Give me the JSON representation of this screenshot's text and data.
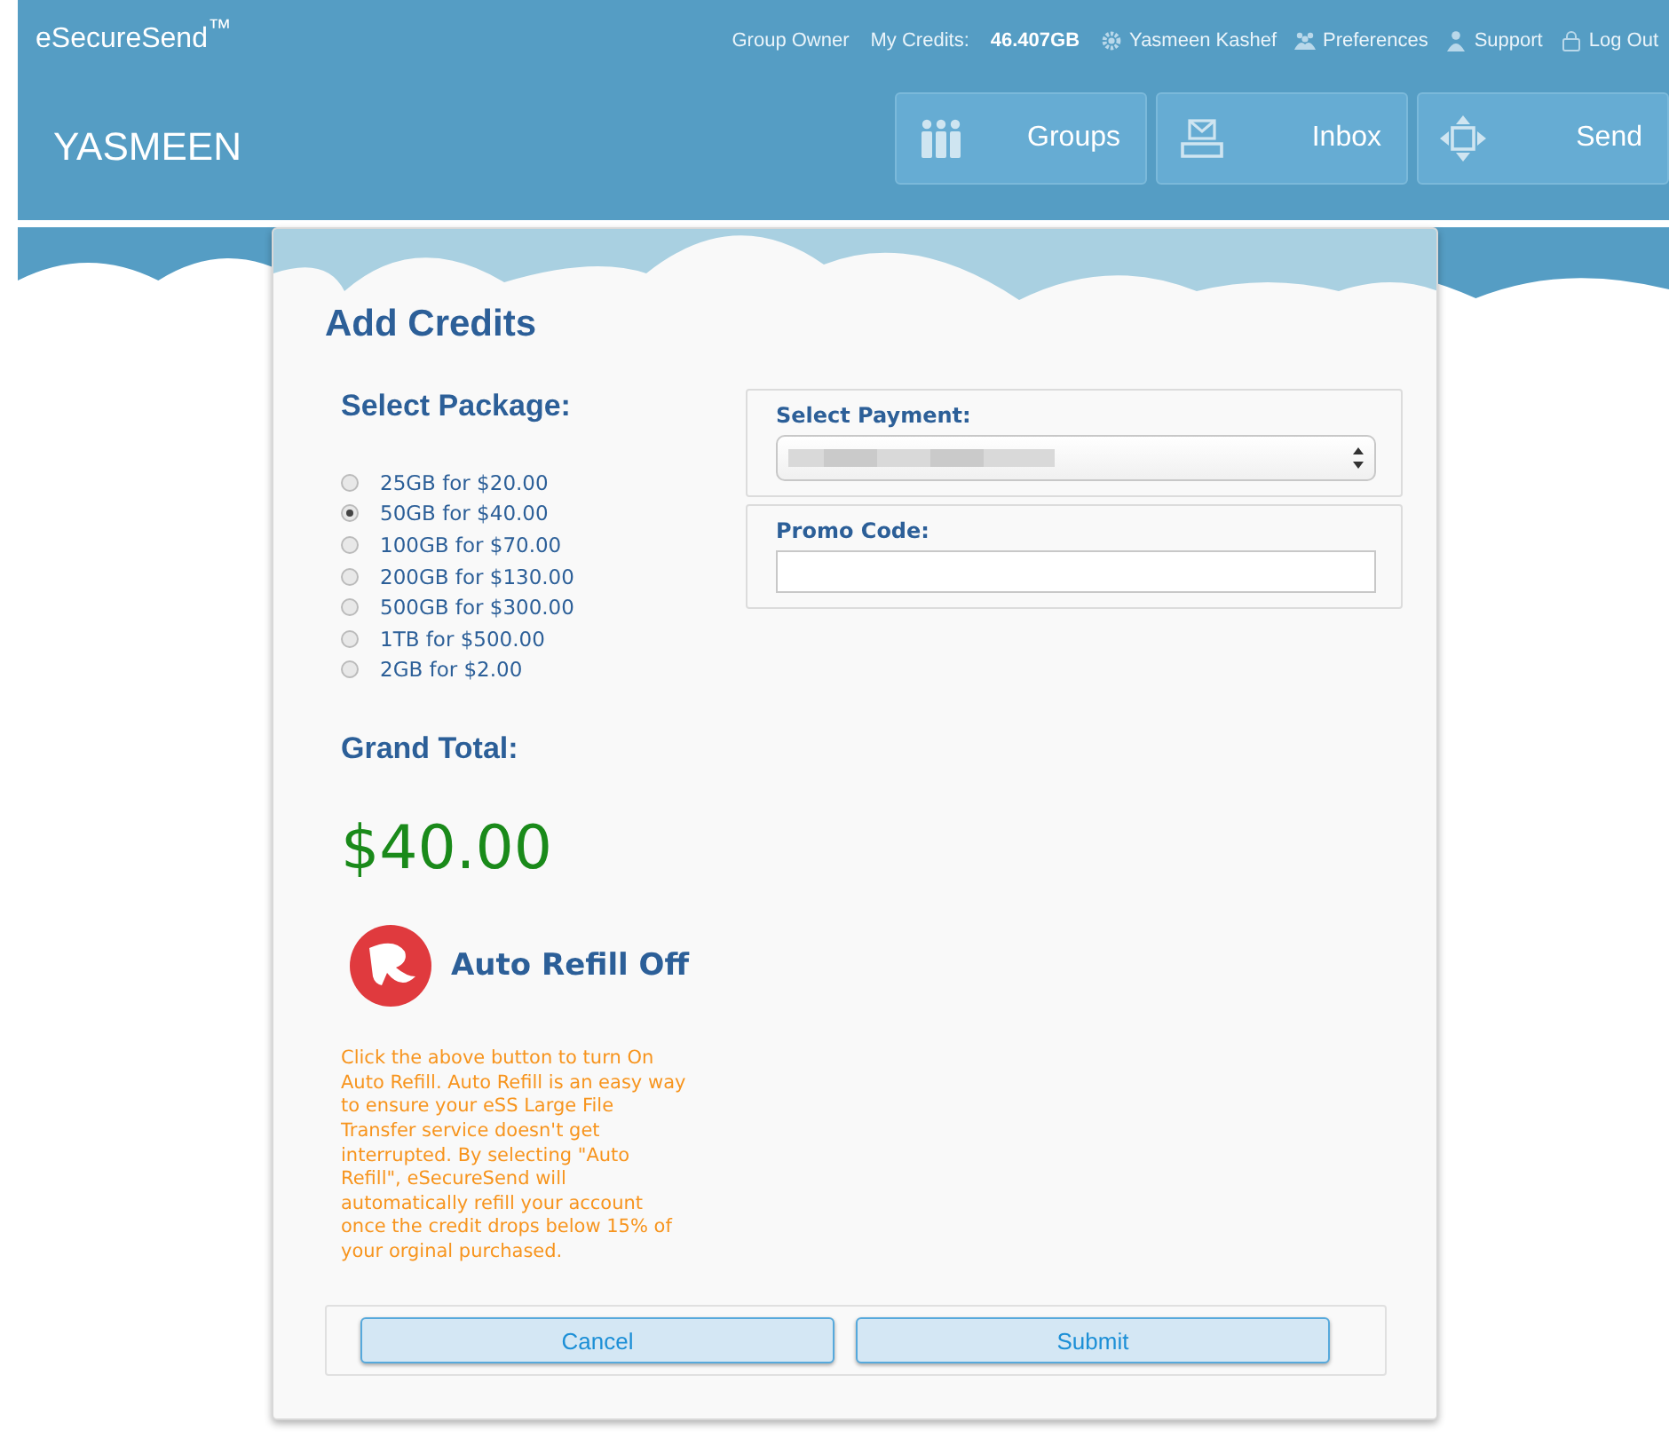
{
  "header": {
    "logo": "eSecureSend$^{™}$",
    "role": "Group Owner",
    "credits_label": "My Credits:",
    "credits_value": "46.407GB",
    "links": [
      {
        "kind": "gear",
        "label": "Yasmeen Kashef"
      },
      {
        "kind": "people",
        "label": "Preferences"
      },
      {
        "kind": "person",
        "label": "Support"
      },
      {
        "kind": "lock",
        "label": "Log Out"
      }
    ],
    "user": "YASMEEN",
    "nav": [
      {
        "kind": "groups",
        "label": "Groups"
      },
      {
        "kind": "inbox",
        "label": "Inbox"
      },
      {
        "kind": "send",
        "label": "Send"
      }
    ]
  },
  "card": {
    "title": "Add Credits",
    "package_heading": "Select Package:",
    "packages": [
      {
        "label": "25GB for $20.00",
        "selected": false
      },
      {
        "label": "50GB for $40.00",
        "selected": true
      },
      {
        "label": "100GB for $70.00",
        "selected": false
      },
      {
        "label": "200GB for $130.00",
        "selected": false
      },
      {
        "label": "500GB for $300.00",
        "selected": false
      },
      {
        "label": "1TB for $500.00",
        "selected": false
      },
      {
        "label": "2GB for $2.00",
        "selected": false
      }
    ],
    "total_heading": "Grand Total:",
    "total": "$40.00",
    "auto_refill": {
      "label": "Auto Refill Off",
      "on": false
    },
    "note": "Click the above button to turn On Auto Refill. Auto Refill is an easy way to ensure your eSS Large File Transfer service doesn't get interrupted. By selecting \"Auto Refill\", eSecureSend will automatically refill your account once the credit drops below 15% of your orginal purchased.",
    "payment_label": "Select Payment:",
    "promo_label": "Promo Code:",
    "buttons": [
      "Cancel",
      "Submit"
    ]
  }
}
